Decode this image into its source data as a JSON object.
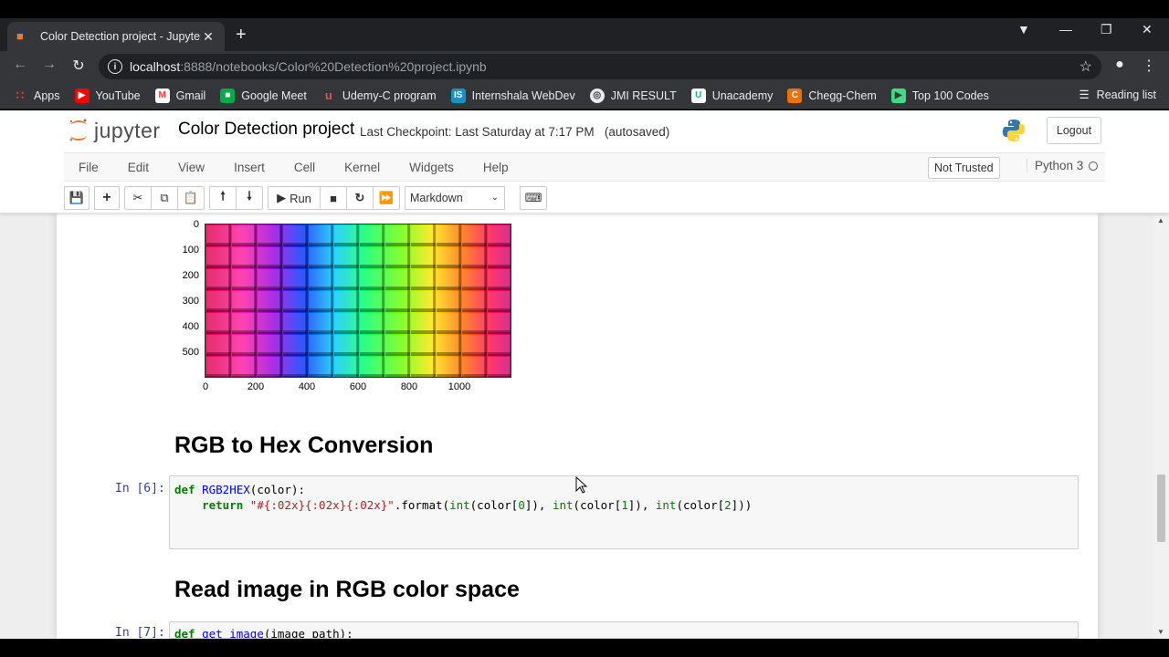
{
  "browser": {
    "tab_title": "Color Detection project - Jupyter",
    "new_tab": "+",
    "url_host": "localhost",
    "url_path": ":8888/notebooks/Color%20Detection%20project.ipynb",
    "bookmarks": [
      {
        "label": "Apps",
        "icon": "apps-grid-icon",
        "color": "#ea4335"
      },
      {
        "label": "YouTube",
        "icon": "youtube-icon",
        "color": "#ff0000"
      },
      {
        "label": "Gmail",
        "icon": "gmail-icon",
        "color": "#ffffff"
      },
      {
        "label": "Google Meet",
        "icon": "google-meet-icon",
        "color": "#00ac47"
      },
      {
        "label": "Udemy-C program",
        "icon": "udemy-icon",
        "color": "#a435f0"
      },
      {
        "label": "Internshala WebDev",
        "icon": "internshala-icon",
        "color": "#1295c9"
      },
      {
        "label": "JMI RESULT",
        "icon": "globe-icon",
        "color": "#e8eaed"
      },
      {
        "label": "Unacademy",
        "icon": "unacademy-icon",
        "color": "#ffffff"
      },
      {
        "label": "Chegg-Chem",
        "icon": "chegg-icon",
        "color": "#eb7100"
      },
      {
        "label": "Top 100 Codes",
        "icon": "top-codes-icon",
        "color": "#3ddc84"
      }
    ],
    "reading_list": "Reading list"
  },
  "jupyter": {
    "logo_text": "jupyter",
    "notebook_name": "Color Detection project",
    "checkpoint": "Last Checkpoint: Last Saturday at 7:17 PM",
    "autosave": "(autosaved)",
    "logout": "Logout",
    "menu": [
      "File",
      "Edit",
      "View",
      "Insert",
      "Cell",
      "Kernel",
      "Widgets",
      "Help"
    ],
    "trusted": "Not Trusted",
    "kernel": "Python 3",
    "run_label": "Run",
    "cell_type": "Markdown"
  },
  "plot": {
    "y_ticks": [
      "0",
      "100",
      "200",
      "300",
      "400",
      "500"
    ],
    "x_ticks": [
      "0",
      "200",
      "400",
      "600",
      "800",
      "1000"
    ]
  },
  "cells": {
    "heading1": "RGB to Hex Conversion",
    "prompt6": "In [6]:",
    "heading2": "Read image in RGB color space",
    "prompt7": "In [7]:"
  }
}
